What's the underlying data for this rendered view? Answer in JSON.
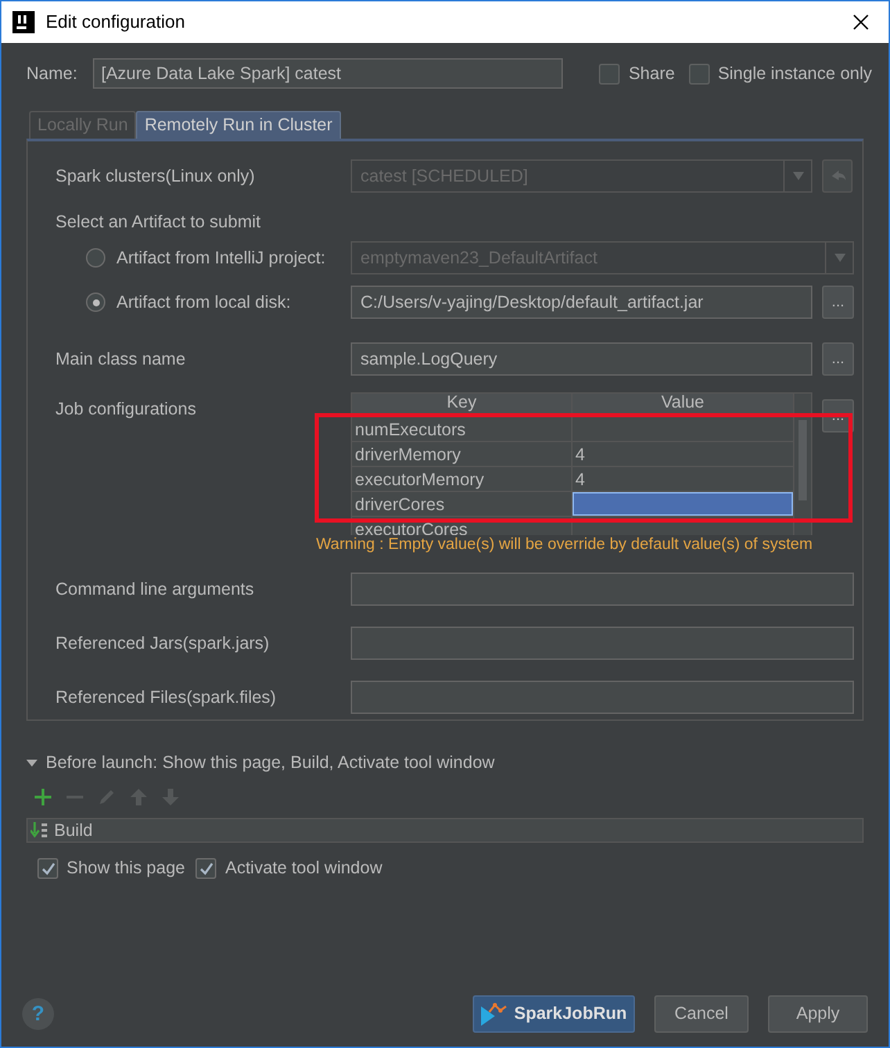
{
  "window": {
    "title": "Edit configuration"
  },
  "name": {
    "label": "Name:",
    "value": "[Azure Data Lake Spark] catest"
  },
  "options": [
    {
      "label": "Share",
      "checked": false
    },
    {
      "label": "Single instance only",
      "checked": false
    }
  ],
  "tabs": [
    {
      "label": "Locally Run",
      "selected": false,
      "disabled": true
    },
    {
      "label": "Remotely Run in Cluster",
      "selected": true,
      "disabled": false
    }
  ],
  "spark_clusters": {
    "label": "Spark clusters(Linux only)",
    "value": "catest [SCHEDULED]",
    "disabled": true
  },
  "artifact": {
    "label": "Select an Artifact to submit",
    "sources": [
      {
        "label": "Artifact from IntelliJ project:",
        "selected": false,
        "kind": "dropdown",
        "value": "emptymaven23_DefaultArtifact",
        "disabled": true
      },
      {
        "label": "Artifact from local disk:",
        "selected": true,
        "kind": "path",
        "value": "C:/Users/v-yajing/Desktop/default_artifact.jar",
        "disabled": false,
        "browse_button": "..."
      }
    ]
  },
  "main_class": {
    "label": "Main class name",
    "value": "sample.LogQuery",
    "browse_button": "..."
  },
  "job_configurations": {
    "label": "Job configurations",
    "edit_button": "...",
    "columns": [
      "Key",
      "Value"
    ],
    "rows": [
      {
        "key": "numExecutors",
        "selected": false
      },
      {
        "key": "driverMemory",
        "value": "4",
        "selected": false
      },
      {
        "key": "executorMemory",
        "value": "4",
        "selected": false
      },
      {
        "key": "driverCores",
        "selected": true
      },
      {
        "key": "executorCores",
        "selected": false
      }
    ]
  },
  "warning": "Warning : Empty value(s) will be override by default value(s) of system",
  "fields": [
    {
      "label": "Command line arguments"
    },
    {
      "label": "Referenced Jars(spark.jars)"
    },
    {
      "label": "Referenced Files(spark.files)"
    }
  ],
  "before_launch": {
    "title": "Before launch: Show this page, Build, Activate tool window",
    "expanded": true,
    "tools": [
      {
        "kind": "add",
        "disabled": false
      },
      {
        "kind": "remove",
        "disabled": true
      },
      {
        "kind": "edit",
        "disabled": true
      },
      {
        "kind": "up",
        "disabled": true
      },
      {
        "kind": "down",
        "disabled": true
      }
    ],
    "tasks": [
      {
        "label": "Build"
      }
    ],
    "options": [
      {
        "label": "Show this page",
        "checked": true
      },
      {
        "label": "Activate tool window",
        "checked": true
      }
    ]
  },
  "help": "?",
  "buttons": [
    {
      "label": "SparkJobRun",
      "kind": "primary"
    },
    {
      "label": "Cancel",
      "kind": "normal"
    },
    {
      "label": "Apply",
      "kind": "normal"
    }
  ]
}
